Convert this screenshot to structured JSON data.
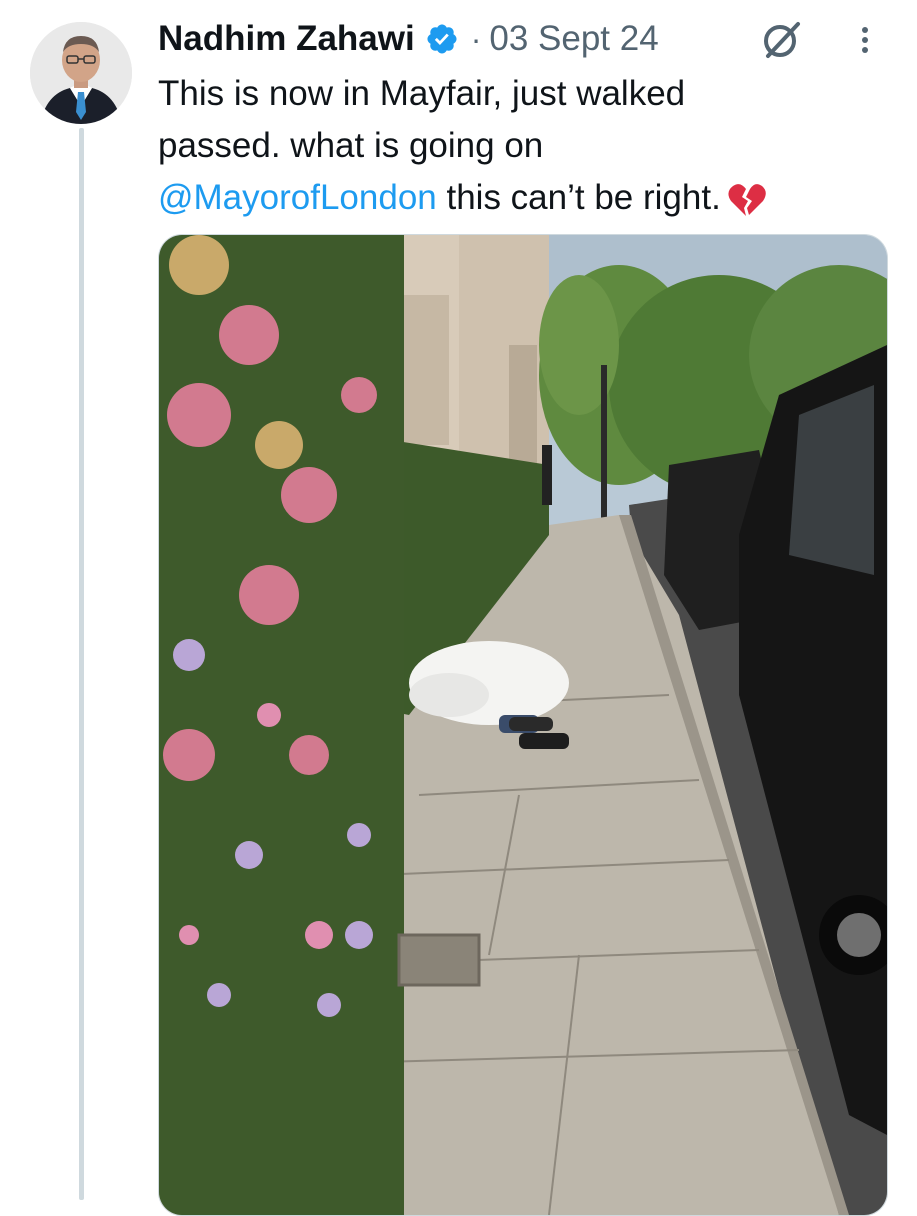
{
  "tweet": {
    "author_name": "Nadhim Zahawi",
    "date": "03 Sept 24",
    "separator": "·",
    "text_line1": "This is now in Mayfair, just walked",
    "text_line2": "passed. what is going on",
    "mention": "@MayorofLondon",
    "text_after_mention": " this can’t be right.",
    "emoji": "broken-heart-emoji"
  },
  "colors": {
    "verified_blue": "#1d9bf0",
    "text": "#0f1419",
    "secondary_text": "#536471",
    "link": "#1d9bf0"
  },
  "icons": {
    "verified": "verified-badge-icon",
    "grok": "grok-icon",
    "more": "more-options-icon"
  },
  "media": {
    "kind": "photo",
    "description": "Street pavement photo with a person lying under a white duvet beside a flower wall and parked cars"
  }
}
